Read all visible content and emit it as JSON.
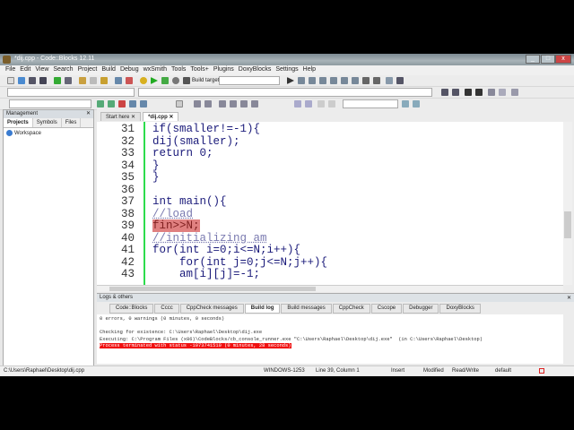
{
  "window": {
    "title": "*dij.cpp - Code::Blocks 12.11"
  },
  "menu": [
    "File",
    "Edit",
    "View",
    "Search",
    "Project",
    "Build",
    "Debug",
    "wxSmith",
    "Tools",
    "Tools+",
    "Plugins",
    "DoxyBlocks",
    "Settings",
    "Help"
  ],
  "toolbar": {
    "build_target_label": "Build target:"
  },
  "management": {
    "title": "Management",
    "tabs": [
      "Projects",
      "Symbols",
      "Files"
    ],
    "tree": [
      "Workspace"
    ]
  },
  "editor": {
    "tabs": [
      "Start here",
      "*dij.cpp"
    ],
    "active_tab": "*dij.cpp",
    "lines": [
      {
        "n": "31",
        "text": "if(smaller!=-1){"
      },
      {
        "n": "32",
        "text": "dij(smaller);"
      },
      {
        "n": "33",
        "text": "return 0;"
      },
      {
        "n": "34",
        "text": "}"
      },
      {
        "n": "35",
        "text": "}"
      },
      {
        "n": "36",
        "text": ""
      },
      {
        "n": "37",
        "text": "int main(){"
      },
      {
        "n": "38",
        "text": "//load"
      },
      {
        "n": "39",
        "text": "fin>>N;"
      },
      {
        "n": "40",
        "text": "//initializing am"
      },
      {
        "n": "41",
        "text": "for(int i=0;i<=N;i++){"
      },
      {
        "n": "42",
        "text": "    for(int j=0;j<=N;j++){"
      },
      {
        "n": "43",
        "text": "    am[i][j]=-1;"
      }
    ]
  },
  "logs": {
    "title": "Logs & others",
    "tabs": [
      "Code::Blocks",
      "Cccc",
      "CppCheck messages",
      "Build log",
      "Build messages",
      "CppCheck",
      "Cscope",
      "Debugger",
      "DoxyBlocks"
    ],
    "active_tab": "Build log",
    "lines": [
      "0 errors, 0 warnings (0 minutes, 0 seconds)",
      "",
      "Checking for existence: C:\\Users\\Raphael\\Desktop\\dij.exe",
      "Executing: C:\\Program Files (x86)\\CodeBlocks/cb_console_runner.exe \"C:\\Users\\Raphael\\Desktop\\dij.exe\"  (in C:\\Users\\Raphael\\Desktop)"
    ],
    "error_line": "Process terminated with status -1073741510 (0 minutes, 28 seconds)"
  },
  "status": {
    "path": "C:\\Users\\Raphael\\Desktop\\dij.cpp",
    "encoding": "WINDOWS-1253",
    "position": "Line 39, Column 1",
    "mode": "Insert",
    "modified": "Modified",
    "access": "Read/Write",
    "profile": "default"
  },
  "colors": {
    "error_highlight": "#e08080",
    "change_bar": "#2ddc4c",
    "error_log": "#f01010"
  }
}
